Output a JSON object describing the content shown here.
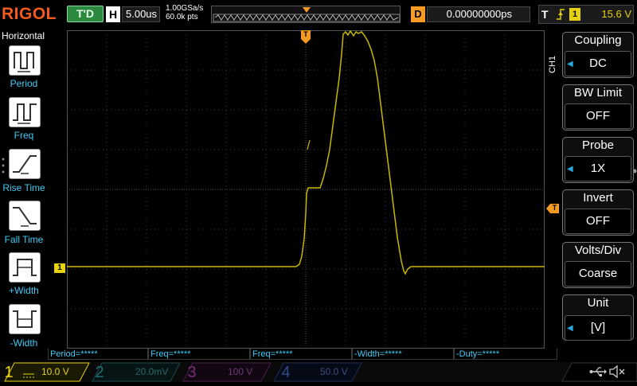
{
  "brand": "RIGOL",
  "status": "T'D",
  "horizontal": {
    "label": "H",
    "timebase": "5.00us",
    "sample_rate": "1.00GSa/s",
    "memory_depth": "60.0k pts"
  },
  "delay": {
    "label": "D",
    "value": "0.00000000ps"
  },
  "trigger": {
    "label": "T",
    "source": "1",
    "level": "15.6 V"
  },
  "left_menu": {
    "title": "Horizontal",
    "items": [
      {
        "label": "Period",
        "icon": "period-icon"
      },
      {
        "label": "Freq",
        "icon": "freq-icon"
      },
      {
        "label": "Rise Time",
        "icon": "rise-time-icon"
      },
      {
        "label": "Fall Time",
        "icon": "fall-time-icon"
      },
      {
        "label": "+Width",
        "icon": "pos-width-icon"
      },
      {
        "label": "-Width",
        "icon": "neg-width-icon"
      }
    ]
  },
  "right_menu": {
    "channel_tab": "CH1",
    "items": [
      {
        "title": "Coupling",
        "value": "DC"
      },
      {
        "title": "BW Limit",
        "value": "OFF"
      },
      {
        "title": "Probe",
        "value": "1X"
      },
      {
        "title": "Invert",
        "value": "OFF"
      },
      {
        "title": "Volts/Div",
        "value": "Coarse"
      },
      {
        "title": "Unit",
        "value": "[V]"
      }
    ]
  },
  "measurements": [
    "Period=*****",
    "Freq=*****",
    "Freq=*****",
    "-Width=*****",
    "-Duty=*****"
  ],
  "channels": [
    {
      "num": "1",
      "scale": "10.0 V",
      "color": "#e5d10d"
    },
    {
      "num": "2",
      "scale": "20.0mV",
      "color": "#22b3c4"
    },
    {
      "num": "3",
      "scale": "100 V",
      "color": "#d838d8"
    },
    {
      "num": "4",
      "scale": "50.0 V",
      "color": "#2f6fe0"
    }
  ],
  "markers": {
    "ch1_ground": "1",
    "trigger_pos": "T"
  },
  "colors": {
    "trace": "#c9b800",
    "accent_orange": "#f59a23",
    "menu_label": "#3ecbf4"
  }
}
